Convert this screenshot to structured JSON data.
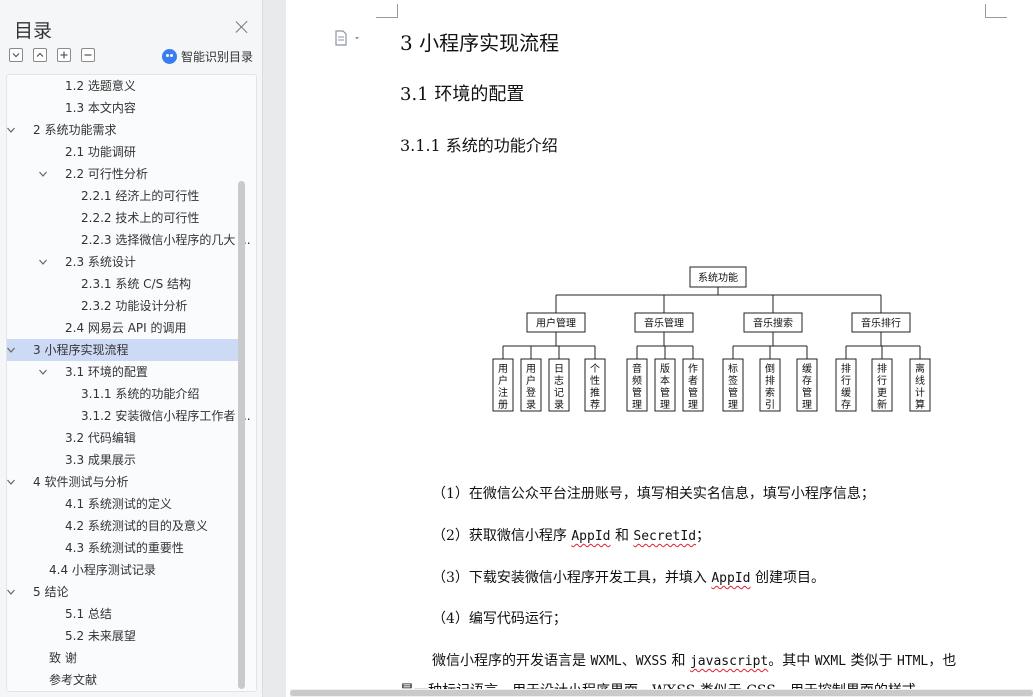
{
  "toc": {
    "title": "目录",
    "smart_label": "智能识别目录",
    "items": [
      {
        "label": "1.2  选题意义",
        "level": 2,
        "chevron": "none"
      },
      {
        "label": "1.3  本文内容",
        "level": 2,
        "chevron": "none"
      },
      {
        "label": "2  系统功能需求",
        "level": 1,
        "chevron": "down"
      },
      {
        "label": "2.1  功能调研",
        "level": 2,
        "chevron": "none"
      },
      {
        "label": "2.2  可行性分析",
        "level": 2,
        "chevron": "down"
      },
      {
        "label": "2.2.1  经济上的可行性",
        "level": 3,
        "chevron": "none"
      },
      {
        "label": "2.2.2  技术上的可行性",
        "level": 3,
        "chevron": "none"
      },
      {
        "label": "2.2.3  选择微信小程序的几大 ...",
        "level": 3,
        "chevron": "none"
      },
      {
        "label": "2.3  系统设计",
        "level": 2,
        "chevron": "down"
      },
      {
        "label": "2.3.1    系统 C/S 结构",
        "level": 3,
        "chevron": "none"
      },
      {
        "label": "2.3.2  功能设计分析",
        "level": 3,
        "chevron": "none"
      },
      {
        "label": "2.4  网易云 API 的调用",
        "level": 2,
        "chevron": "none"
      },
      {
        "label": "3  小程序实现流程",
        "level": 1,
        "chevron": "down",
        "active": true
      },
      {
        "label": "3.1  环境的配置",
        "level": 2,
        "chevron": "down"
      },
      {
        "label": "3.1.1  系统的功能介绍",
        "level": 3,
        "chevron": "none"
      },
      {
        "label": "3.1.2  安装微信小程序工作者 ...",
        "level": 3,
        "chevron": "none"
      },
      {
        "label": "3.2  代码编辑",
        "level": 2,
        "chevron": "none"
      },
      {
        "label": "3.3  成果展示",
        "level": 2,
        "chevron": "none"
      },
      {
        "label": "4    软件测试与分析",
        "level": 1,
        "chevron": "down"
      },
      {
        "label": "4.1     系统测试的定义",
        "level": 2,
        "chevron": "none"
      },
      {
        "label": "4.2     系统测试的目的及意义",
        "level": 2,
        "chevron": "none"
      },
      {
        "label": "4.3     系统测试的重要性",
        "level": 2,
        "chevron": "none"
      },
      {
        "label": "4.4    小程序测试记录",
        "level": 1.5,
        "chevron": "none"
      },
      {
        "label": "5  结论",
        "level": 1,
        "chevron": "down"
      },
      {
        "label": "5.1  总结",
        "level": 2,
        "chevron": "none"
      },
      {
        "label": "5.2  未来展望",
        "level": 2,
        "chevron": "none"
      },
      {
        "label": "致    谢",
        "level": 1.5,
        "chevron": "none"
      },
      {
        "label": "参考文献",
        "level": 1.5,
        "chevron": "none"
      }
    ]
  },
  "doc": {
    "h1": "3  小程序实现流程",
    "h2": "3.1  环境的配置",
    "h3": "3.1.1  系统的功能介绍",
    "diagram": {
      "root": "系统功能",
      "groups": [
        {
          "name": "用户管理",
          "children": [
            "用户注册",
            "用户登录",
            "日志记录",
            "个性推荐"
          ]
        },
        {
          "name": "音乐管理",
          "children": [
            "音频管理",
            "版本管理",
            "作者管理"
          ]
        },
        {
          "name": "音乐搜索",
          "children": [
            "标签管理",
            "倒排索引",
            "缓存管理"
          ]
        },
        {
          "name": "音乐排行",
          "children": [
            "排行缓存",
            "排行更新",
            "离线计算"
          ]
        }
      ]
    },
    "p1": "（1）在微信公众平台注册账号，填写相关实名信息，填写小程序信息；",
    "p2_a": "（2）获取微信小程序 ",
    "p2_b": "AppId",
    "p2_c": " 和 ",
    "p2_d": "SecretId",
    "p2_e": "；",
    "p3_a": "（3）下载安装微信小程序开发工具，并填入 ",
    "p3_b": "AppId",
    "p3_c": " 创建项目。",
    "p4": "（4）编写代码运行；",
    "p5_a": "微信小程序的开发语言是 ",
    "p5_b": "WXML",
    "p5_c": "、",
    "p5_d": "WXSS",
    "p5_e": " 和 ",
    "p5_f": "javascript",
    "p5_g": "。其中 ",
    "p5_h": "WXML",
    "p5_i": " 类似于 ",
    "p5_j": "HTML",
    "p5_k": "，也",
    "p6": "是一种标记语言，用于设计小程序界面，WXSS 类似于 CSS，用于控制界面的样式"
  }
}
